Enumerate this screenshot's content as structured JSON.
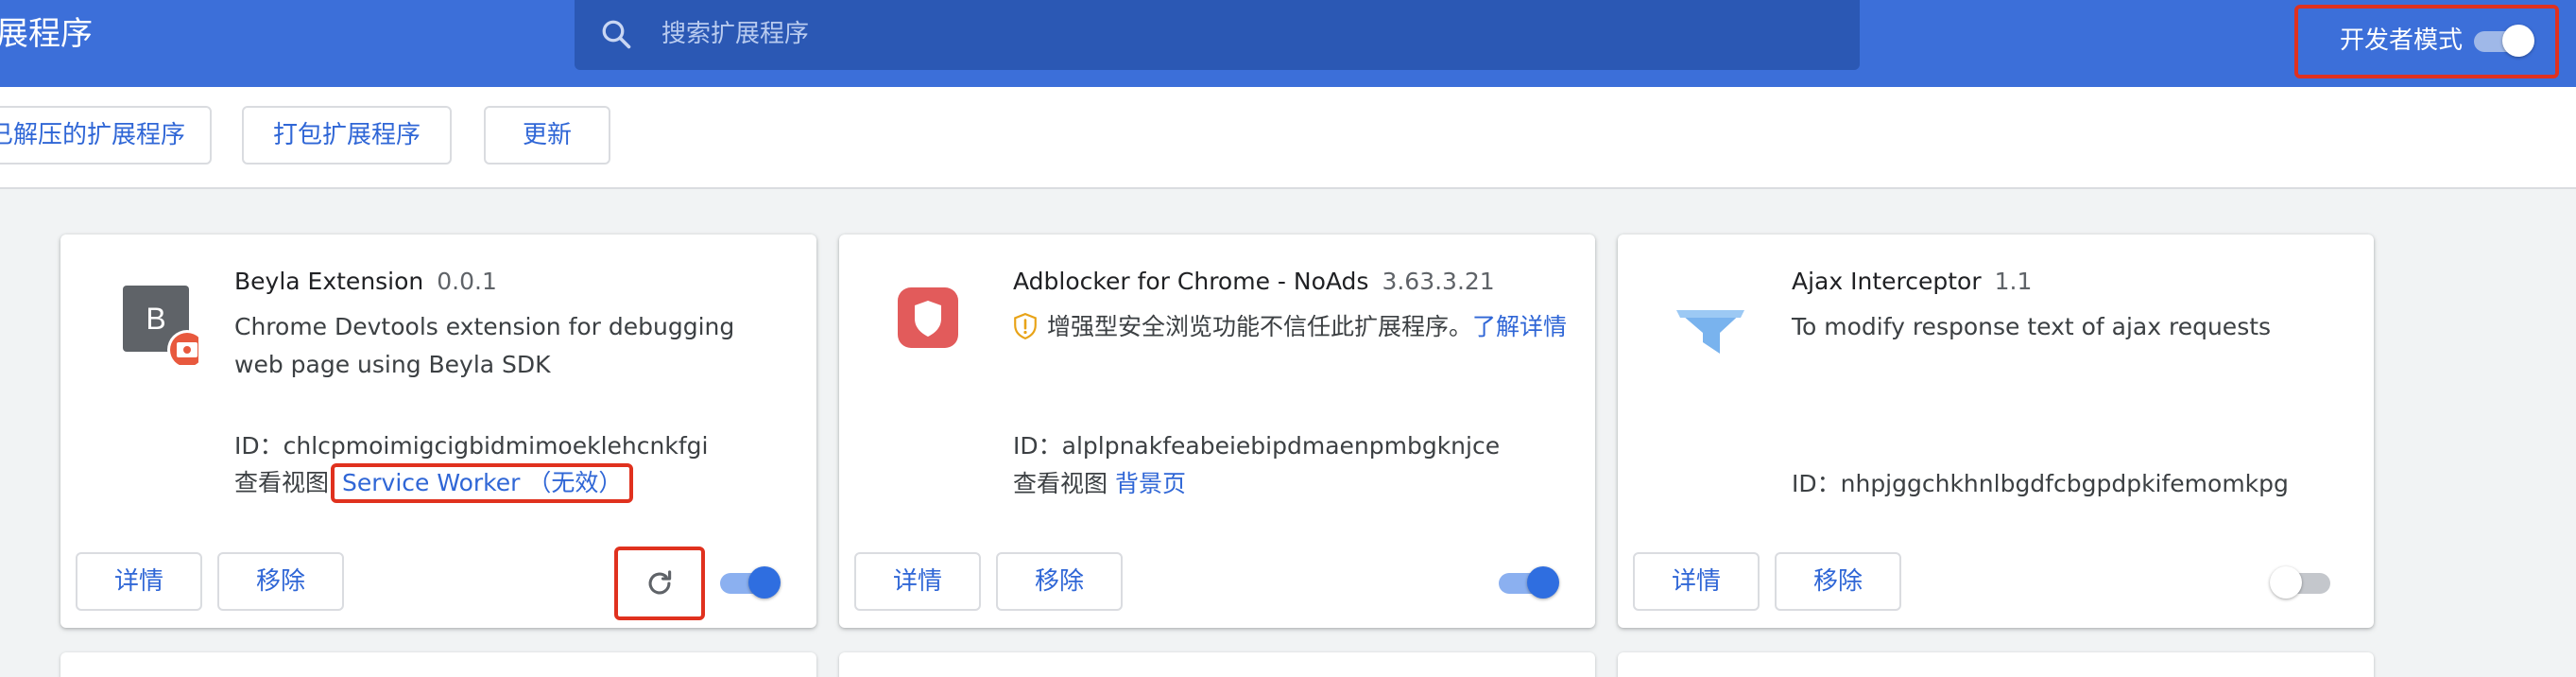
{
  "header": {
    "title": "展程序",
    "search_placeholder": "搜索扩展程序",
    "dev_mode_label": "开发者模式",
    "dev_mode_on": true
  },
  "toolbar": {
    "load_unpacked": "已解压的扩展程序",
    "pack": "打包扩展程序",
    "update": "更新"
  },
  "extensions": [
    {
      "name": "Beyla Extension",
      "version": "0.0.1",
      "icon": "beyla-letter-b-icon",
      "icon_letter": "B",
      "description": "Chrome Devtools extension for debugging web page using Beyla SDK",
      "id_label": "ID：",
      "id": "chlcpmoimigcigbidmimoeklehcnkfgi",
      "views_label": "查看视图",
      "view_link": "Service Worker （无效）",
      "details": "详情",
      "remove": "移除",
      "enabled": true,
      "show_reload": true
    },
    {
      "name": "Adblocker for Chrome - NoAds",
      "version": "3.63.3.21",
      "icon": "shield-icon",
      "warning": "增强型安全浏览功能不信任此扩展程序。",
      "warning_link": "了解详情",
      "id_label": "ID：",
      "id": "alplpnakfeabeiebipdmaenpmbgknjce",
      "views_label": "查看视图",
      "view_link": "背景页",
      "details": "详情",
      "remove": "移除",
      "enabled": true
    },
    {
      "name": "Ajax Interceptor",
      "version": "1.1",
      "icon": "funnel-icon",
      "description": "To modify response text of ajax requests",
      "id_label": "ID：",
      "id": "nhpjggchkhnlbgdfcbgpdpkifemomkpg",
      "details": "详情",
      "remove": "移除",
      "enabled": false
    }
  ],
  "colors": {
    "header_bg": "#3c6fd9",
    "search_bg": "#2b58b4",
    "accent": "#2f66d6",
    "highlight_border": "#e0311e",
    "page_bg": "#f1f3f4"
  }
}
